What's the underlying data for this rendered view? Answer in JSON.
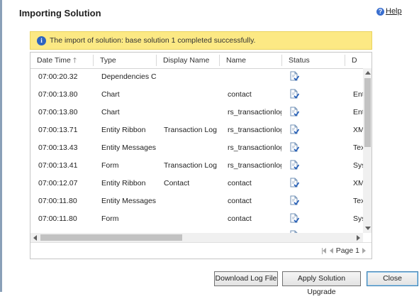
{
  "dialog": {
    "title": "Importing Solution",
    "help_label": "Help",
    "help_icon": "question-icon"
  },
  "banner": {
    "icon": "info-icon",
    "message": "The import of solution: base solution 1 completed successfully.",
    "background": "#fce984"
  },
  "grid": {
    "columns": [
      "Date Time",
      "Type",
      "Display Name",
      "Name",
      "Status",
      "D"
    ],
    "sort": {
      "column": "Date Time",
      "direction": "ascending",
      "icon": "arrow-up-icon"
    },
    "status_icon": "document-check-icon",
    "rows": [
      {
        "time": "07:00:20.32",
        "type": "Dependencies C...",
        "display_name": "",
        "name": "",
        "desc": ""
      },
      {
        "time": "07:00:13.80",
        "type": "Chart",
        "display_name": "",
        "name": "contact",
        "desc": "Ent"
      },
      {
        "time": "07:00:13.80",
        "type": "Chart",
        "display_name": "",
        "name": "rs_transactionlog",
        "desc": "Ent"
      },
      {
        "time": "07:00:13.71",
        "type": "Entity Ribbon",
        "display_name": "Transaction Log",
        "name": "rs_transactionlog",
        "desc": "XM"
      },
      {
        "time": "07:00:13.43",
        "type": "Entity Messages",
        "display_name": "",
        "name": "rs_transactionlog",
        "desc": "Tex"
      },
      {
        "time": "07:00:13.41",
        "type": "Form",
        "display_name": "Transaction Log",
        "name": "rs_transactionlog",
        "desc": "Sys"
      },
      {
        "time": "07:00:12.07",
        "type": "Entity Ribbon",
        "display_name": "Contact",
        "name": "contact",
        "desc": "XM"
      },
      {
        "time": "07:00:11.80",
        "type": "Entity Messages",
        "display_name": "",
        "name": "contact",
        "desc": "Tex"
      },
      {
        "time": "07:00:11.80",
        "type": "Form",
        "display_name": "",
        "name": "contact",
        "desc": "Sys"
      }
    ]
  },
  "pager": {
    "label": "Page 1"
  },
  "buttons": {
    "download_log": "Download Log File",
    "apply_upgrade": "Apply Solution Upgrade",
    "close": "Close"
  }
}
